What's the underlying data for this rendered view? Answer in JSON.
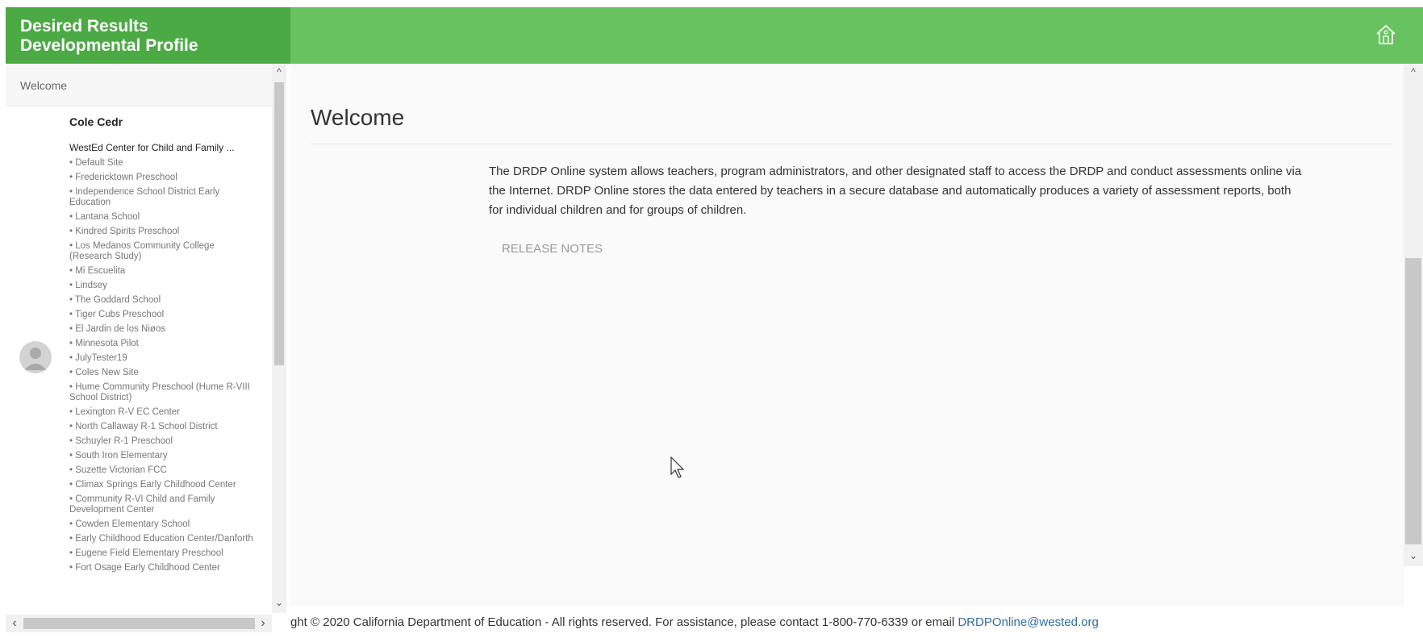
{
  "header": {
    "brand_line1": "Desired Results",
    "brand_line2": "Developmental Profile",
    "home_icon": "home-icon",
    "colors": {
      "bar": "#66c35f",
      "brand": "#4caa45"
    }
  },
  "sidebar": {
    "welcome_label": "Welcome",
    "user_name": "Cole Cedr",
    "agency": "WestEd Center for Child and Family ...",
    "sites": [
      "Default Site",
      "Fredericktown Preschool",
      "Independence School District Early Education",
      "Lantana School",
      "Kindred Spirits Preschool",
      "Los Medanos Community College (Research Study)",
      "Mi Escuelita",
      "Lindsey",
      "The Goddard School",
      "Tiger Cubs Preschool",
      "El Jardin de los Niøos",
      "Minnesota Pilot",
      "JulyTester19",
      "Coles New Site",
      "Hume Community Preschool (Hume R-VIII School District)",
      "Lexington R-V EC Center",
      "North Callaway R-1 School District",
      "Schuyler R-1 Preschool",
      "South Iron Elementary",
      "Suzette Victorian FCC",
      "Climax Springs Early Childhood Center",
      "Community R-VI Child and Family Development Center",
      "Cowden Elementary School",
      "Early Childhood Education Center/Danforth",
      "Eugene Field Elementary Preschool",
      "Fort Osage Early Childhood Center"
    ]
  },
  "main": {
    "title": "Welcome",
    "intro": "The DRDP Online system allows teachers, program administrators, and other designated staff to access the DRDP and conduct assessments online via the Internet. DRDP Online stores the data entered by teachers in a secure database and automatically produces a variety of assessment reports, both for individual children and for groups of children.",
    "release_notes": "RELEASE NOTES"
  },
  "footer": {
    "text": "ght © 2020 California Department of Education - All rights reserved. For assistance, please contact 1-800-770-6339 or email ",
    "email": "DRDPOnline@wested.org",
    "link_color": "#2e6da4"
  }
}
